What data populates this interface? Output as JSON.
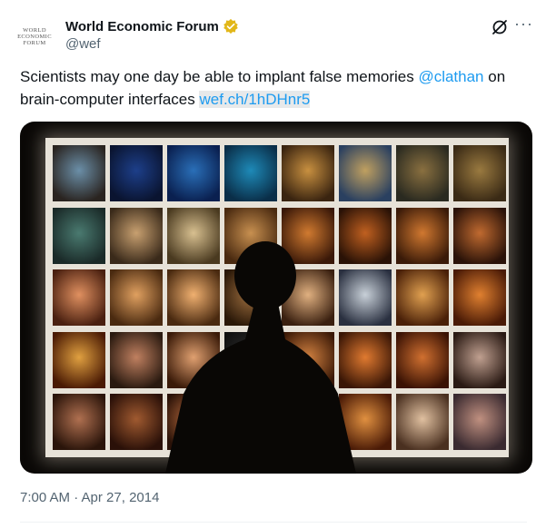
{
  "author": {
    "display_name": "World Economic Forum",
    "handle": "@wef",
    "avatar_text": "WORLD ECONOMIC FORUM",
    "verified_color": "#e2b719"
  },
  "tweet": {
    "text_before": "Scientists may one day be able to implant false memories ",
    "mention": "@clathan",
    "text_after": " on brain-computer interfaces ",
    "link": "wef.ch/1hDHnr5",
    "link_color": "#1d9bf0"
  },
  "actions": {
    "grok_icon": "grok-icon",
    "more_icon": "more-icon",
    "more_label": "···"
  },
  "media": {
    "description_icon": "embryo-photo-grid"
  },
  "meta": {
    "timestamp": "7:00 AM · Apr 27, 2014"
  }
}
